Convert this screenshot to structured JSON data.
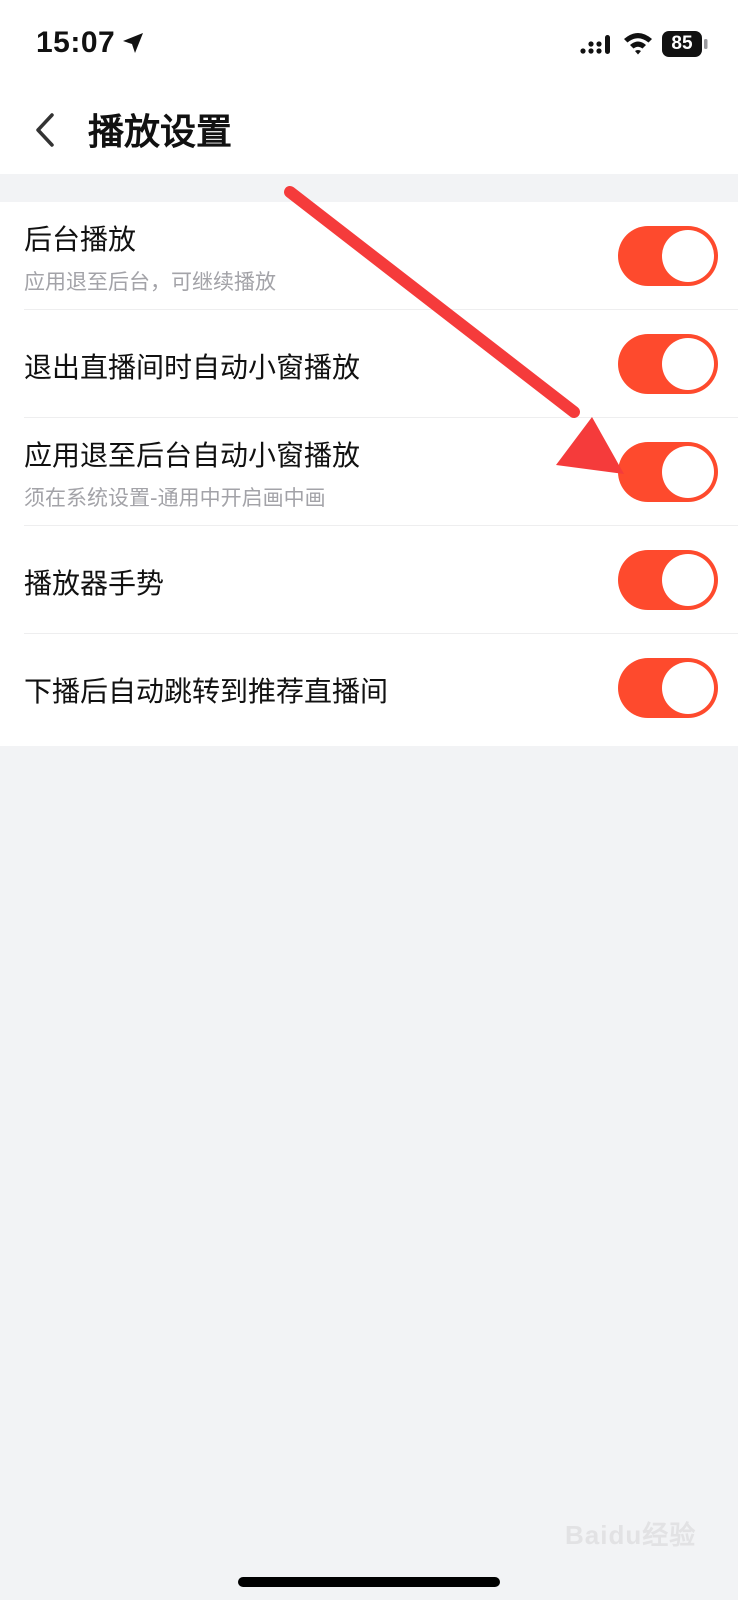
{
  "status_bar": {
    "time": "15:07",
    "battery": "85",
    "icons": [
      "location-arrow-icon",
      "signal-icon",
      "wifi-icon",
      "battery-icon"
    ]
  },
  "header": {
    "title": "播放设置",
    "back_icon": "chevron-left-icon"
  },
  "settings": [
    {
      "title": "后台播放",
      "subtitle": "应用退至后台，可继续播放",
      "on": true
    },
    {
      "title": "退出直播间时自动小窗播放",
      "subtitle": "",
      "on": true
    },
    {
      "title": "应用退至后台自动小窗播放",
      "subtitle": "须在系统设置-通用中开启画中画",
      "on": true
    },
    {
      "title": "播放器手势",
      "subtitle": "",
      "on": true
    },
    {
      "title": "下播后自动跳转到推荐直播间",
      "subtitle": "",
      "on": true
    }
  ],
  "colors": {
    "toggle_on": "#fe4a2d",
    "annotation_arrow": "#f53b3b",
    "page_background": "#f2f3f5"
  },
  "watermark": "Baidu经验"
}
